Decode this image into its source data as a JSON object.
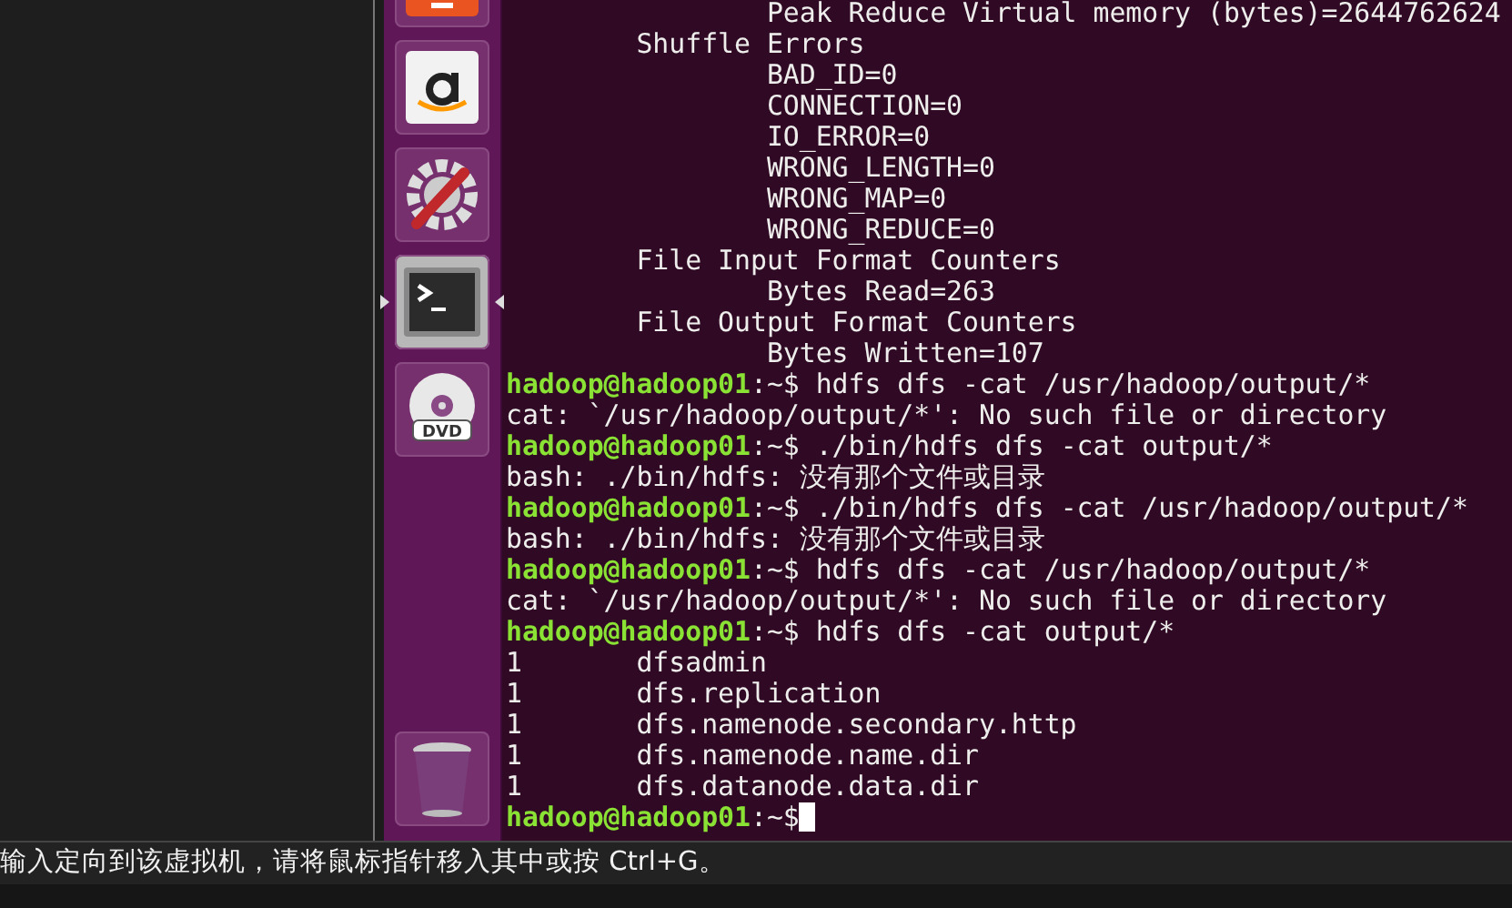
{
  "launcher": [
    {
      "kind": "software",
      "selected": false
    },
    {
      "kind": "amazon",
      "selected": false
    },
    {
      "kind": "settings",
      "selected": false
    },
    {
      "kind": "terminal",
      "selected": true
    },
    {
      "kind": "dvd",
      "selected": false,
      "label": "DVD"
    },
    {
      "kind": "trash",
      "selected": false
    }
  ],
  "terminal": {
    "lines": [
      {
        "kind": "output",
        "text": "                Peak Reduce Virtual memory (bytes)=2644762624"
      },
      {
        "kind": "output",
        "text": "        Shuffle Errors"
      },
      {
        "kind": "output",
        "text": "                BAD_ID=0"
      },
      {
        "kind": "output",
        "text": "                CONNECTION=0"
      },
      {
        "kind": "output",
        "text": "                IO_ERROR=0"
      },
      {
        "kind": "output",
        "text": "                WRONG_LENGTH=0"
      },
      {
        "kind": "output",
        "text": "                WRONG_MAP=0"
      },
      {
        "kind": "output",
        "text": "                WRONG_REDUCE=0"
      },
      {
        "kind": "output",
        "text": "        File Input Format Counters"
      },
      {
        "kind": "output",
        "text": "                Bytes Read=263"
      },
      {
        "kind": "output",
        "text": "        File Output Format Counters"
      },
      {
        "kind": "output",
        "text": "                Bytes Written=107"
      },
      {
        "kind": "prompt",
        "user": "hadoop@hadoop01",
        "command": ":~$ hdfs dfs -cat /usr/hadoop/output/*"
      },
      {
        "kind": "output",
        "text": "cat: `/usr/hadoop/output/*': No such file or directory"
      },
      {
        "kind": "prompt",
        "user": "hadoop@hadoop01",
        "command": ":~$ ./bin/hdfs dfs -cat output/*"
      },
      {
        "kind": "output",
        "text": "bash: ./bin/hdfs: 没有那个文件或目录"
      },
      {
        "kind": "prompt",
        "user": "hadoop@hadoop01",
        "command": ":~$ ./bin/hdfs dfs -cat /usr/hadoop/output/*"
      },
      {
        "kind": "output",
        "text": "bash: ./bin/hdfs: 没有那个文件或目录"
      },
      {
        "kind": "prompt",
        "user": "hadoop@hadoop01",
        "command": ":~$ hdfs dfs -cat /usr/hadoop/output/*"
      },
      {
        "kind": "output",
        "text": "cat: `/usr/hadoop/output/*': No such file or directory"
      },
      {
        "kind": "prompt",
        "user": "hadoop@hadoop01",
        "command": ":~$ hdfs dfs -cat output/*"
      },
      {
        "kind": "output",
        "text": "1       dfsadmin"
      },
      {
        "kind": "output",
        "text": "1       dfs.replication"
      },
      {
        "kind": "output",
        "text": "1       dfs.namenode.secondary.http"
      },
      {
        "kind": "output",
        "text": "1       dfs.namenode.name.dir"
      },
      {
        "kind": "output",
        "text": "1       dfs.datanode.data.dir"
      },
      {
        "kind": "prompt",
        "user": "hadoop@hadoop01",
        "command": ":~$",
        "cursor": true
      }
    ]
  },
  "status_bar": {
    "text": "输入定向到该虚拟机，请将鼠标指针移入其中或按 Ctrl+G。"
  }
}
